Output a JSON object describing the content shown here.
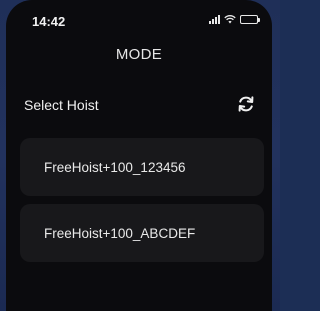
{
  "status_bar": {
    "time": "14:42",
    "signal_icon": "signal-bars-icon",
    "wifi_icon": "wifi-icon",
    "battery_icon": "battery-full-icon"
  },
  "nav": {
    "title": "MODE"
  },
  "section": {
    "title": "Select Hoist",
    "refresh_icon": "refresh-icon"
  },
  "hoists": [
    {
      "name": "FreeHoist+100_123456"
    },
    {
      "name": "FreeHoist+100_ABCDEF"
    }
  ],
  "colors": {
    "background": "#0b0b0e",
    "card": "#18181b",
    "text": "#e9e9e9",
    "outer_frame": "#1f2f58"
  }
}
